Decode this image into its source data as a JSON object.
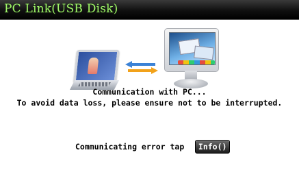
{
  "window": {
    "title": "PC Link(USB Disk)"
  },
  "message": {
    "line1": "Communication with PC...",
    "line2": "To avoid data loss, please ensure not to be interrupted."
  },
  "error_row": {
    "label": "Communicating error tap",
    "button_label": "Info()"
  },
  "illustration": {
    "left_icon": "laptop-icon",
    "middle_icon": "transfer-arrows-icon",
    "right_icon": "monitor-icon"
  },
  "colors": {
    "title_text": "#9ff26a",
    "title_bar": "#101010",
    "arrow_blue": "#3b82d6",
    "arrow_orange": "#f2a21a"
  }
}
